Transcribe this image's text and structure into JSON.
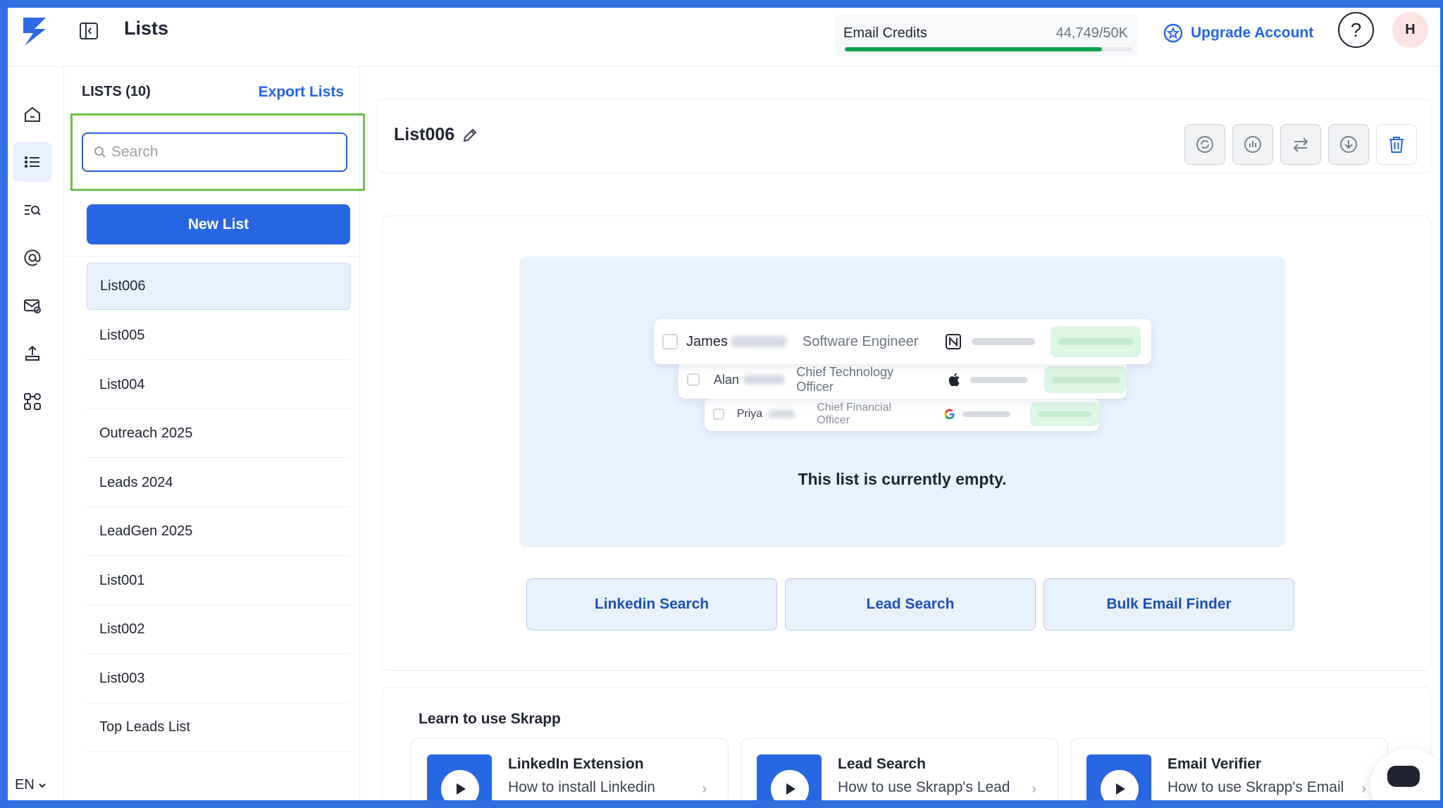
{
  "app": {
    "page_title": "Lists"
  },
  "credits": {
    "label": "Email Credits",
    "value": "44,749/50K",
    "used_fraction": 0.895
  },
  "header": {
    "upgrade_label": "Upgrade Account",
    "help_label": "?",
    "avatar_initial": "H"
  },
  "rail": {
    "items": [
      "home-icon",
      "lists-icon",
      "search-list-icon",
      "at-sign-icon",
      "mail-verify-icon",
      "upload-icon",
      "integrations-icon"
    ],
    "language": "EN"
  },
  "lists_panel": {
    "heading": "LISTS (10)",
    "export_label": "Export Lists",
    "search_placeholder": "Search",
    "new_list_label": "New List",
    "items": [
      {
        "label": "List006"
      },
      {
        "label": "List005"
      },
      {
        "label": "List004"
      },
      {
        "label": "Outreach 2025"
      },
      {
        "label": "Leads 2024"
      },
      {
        "label": "LeadGen 2025"
      },
      {
        "label": "List001"
      },
      {
        "label": "List002"
      },
      {
        "label": "List003"
      },
      {
        "label": "Top Leads List"
      }
    ]
  },
  "list_detail": {
    "title": "List006",
    "empty_text": "This list is currently empty.",
    "mock_rows": [
      {
        "name": "James",
        "title": "Software Engineer",
        "logo": "notion-icon"
      },
      {
        "name": "Alan",
        "title": "Chief Technology Officer",
        "logo": "apple-icon"
      },
      {
        "name": "Priya",
        "title": "Chief Financial Officer",
        "logo": "google-icon"
      }
    ],
    "ctas": [
      {
        "label": "Linkedin Search"
      },
      {
        "label": "Lead Search"
      },
      {
        "label": "Bulk Email Finder"
      }
    ]
  },
  "learn": {
    "title": "Learn to use Skrapp",
    "tutorials": [
      {
        "title": "LinkedIn Extension",
        "desc": "How to install Linkedin Chrome extension"
      },
      {
        "title": "Lead Search",
        "desc": "How to use Skrapp's Lead Search"
      },
      {
        "title": "Email Verifier",
        "desc": "How to use Skrapp's Email Verification"
      }
    ]
  },
  "colors": {
    "brand": "#2867e2",
    "credits_bar": "#12a150",
    "highlight_frame": "#6cc04a"
  }
}
